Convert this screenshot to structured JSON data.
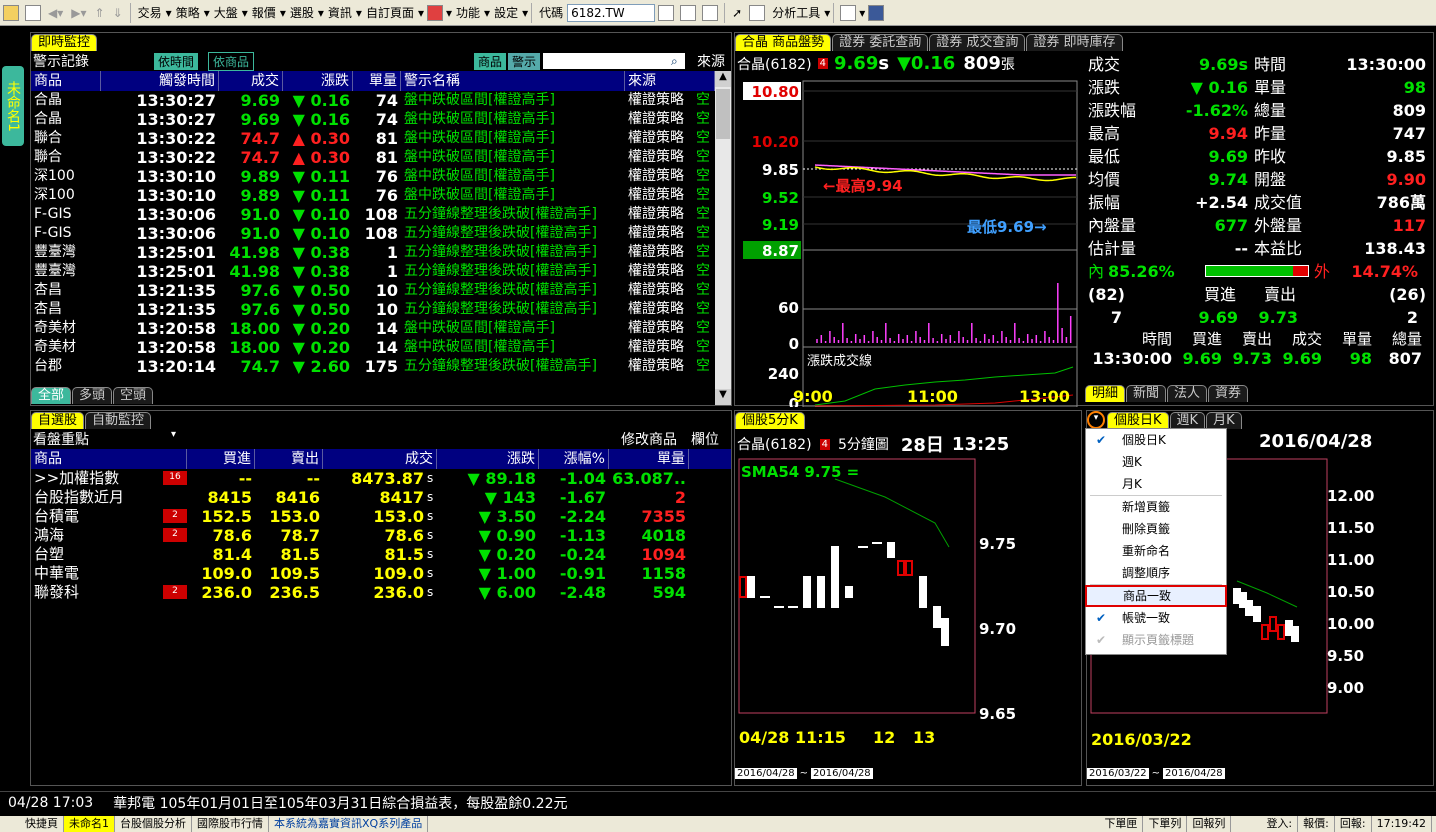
{
  "toolbar": {
    "items": [
      "交易",
      "策略",
      "大盤",
      "報價",
      "選股",
      "資訊",
      "自訂頁面",
      "功能",
      "設定"
    ],
    "code_label": "代碼",
    "code_value": "6182.TW",
    "analysis": "分析工具"
  },
  "sidetab": "未命名1",
  "alerts": {
    "tab": "即時監控",
    "title": "警示記錄",
    "btn_time": "依時間",
    "btn_product": "依商品",
    "search_tabs": [
      "商品",
      "警示"
    ],
    "source": "來源",
    "columns": [
      "商品",
      "觸發時間",
      "成交",
      "漲跌",
      "單量",
      "警示名稱",
      "來源"
    ],
    "rows": [
      [
        "合晶",
        "13:30:27",
        "9.69",
        "▼",
        "0.16",
        "74",
        "盤中跌破區間[權證高手]",
        "權證策略",
        "空",
        "g"
      ],
      [
        "合晶",
        "13:30:27",
        "9.69",
        "▼",
        "0.16",
        "74",
        "盤中跌破區間[權證高手]",
        "權證策略",
        "空",
        "g"
      ],
      [
        "聯合",
        "13:30:22",
        "74.7",
        "▲",
        "0.30",
        "81",
        "盤中跌破區間[權證高手]",
        "權證策略",
        "空",
        "r"
      ],
      [
        "聯合",
        "13:30:22",
        "74.7",
        "▲",
        "0.30",
        "81",
        "盤中跌破區間[權證高手]",
        "權證策略",
        "空",
        "r"
      ],
      [
        "深100",
        "13:30:10",
        "9.89",
        "▼",
        "0.11",
        "76",
        "盤中跌破區間[權證高手]",
        "權證策略",
        "空",
        "g"
      ],
      [
        "深100",
        "13:30:10",
        "9.89",
        "▼",
        "0.11",
        "76",
        "盤中跌破區間[權證高手]",
        "權證策略",
        "空",
        "g"
      ],
      [
        "F-GIS",
        "13:30:06",
        "91.0",
        "▼",
        "0.10",
        "108",
        "五分鐘線整理後跌破[權證高手]",
        "權證策略",
        "空",
        "g"
      ],
      [
        "F-GIS",
        "13:30:06",
        "91.0",
        "▼",
        "0.10",
        "108",
        "五分鐘線整理後跌破[權證高手]",
        "權證策略",
        "空",
        "g"
      ],
      [
        "豐臺灣",
        "13:25:01",
        "41.98",
        "▼",
        "0.38",
        "1",
        "五分鐘線整理後跌破[權證高手]",
        "權證策略",
        "空",
        "g"
      ],
      [
        "豐臺灣",
        "13:25:01",
        "41.98",
        "▼",
        "0.38",
        "1",
        "五分鐘線整理後跌破[權證高手]",
        "權證策略",
        "空",
        "g"
      ],
      [
        "杏昌",
        "13:21:35",
        "97.6",
        "▼",
        "0.50",
        "10",
        "五分鐘線整理後跌破[權證高手]",
        "權證策略",
        "空",
        "g"
      ],
      [
        "杏昌",
        "13:21:35",
        "97.6",
        "▼",
        "0.50",
        "10",
        "五分鐘線整理後跌破[權證高手]",
        "權證策略",
        "空",
        "g"
      ],
      [
        "奇美材",
        "13:20:58",
        "18.00",
        "▼",
        "0.20",
        "14",
        "盤中跌破區間[權證高手]",
        "權證策略",
        "空",
        "g"
      ],
      [
        "奇美材",
        "13:20:58",
        "18.00",
        "▼",
        "0.20",
        "14",
        "盤中跌破區間[權證高手]",
        "權證策略",
        "空",
        "g"
      ],
      [
        "台郡",
        "13:20:14",
        "74.7",
        "▼",
        "2.60",
        "175",
        "五分鐘線整理後跌破[權證高手]",
        "權證策略",
        "空",
        "g"
      ]
    ],
    "bottom_tabs": [
      "全部",
      "多頭",
      "空頭"
    ]
  },
  "watch": {
    "tabs": [
      "自選股",
      "自動監控"
    ],
    "view": "看盤重點",
    "edit": "修改商品",
    "cols_btn": "欄位",
    "columns": [
      "商品",
      "買進",
      "賣出",
      "成交",
      "漲跌",
      "漲幅%",
      "單量"
    ],
    "rows": [
      [
        ">>加權指數",
        "16",
        "--",
        "--",
        "8473.87",
        "s",
        "▼",
        "89.18",
        "-1.04",
        "63.087..",
        "g"
      ],
      [
        "台股指數近月",
        "",
        "8415",
        "8416",
        "8417",
        "s",
        "▼",
        "143",
        "-1.67",
        "2",
        "r"
      ],
      [
        "台積電",
        "2",
        "152.5",
        "153.0",
        "153.0",
        "s",
        "▼",
        "3.50",
        "-2.24",
        "7355",
        "r"
      ],
      [
        "鴻海",
        "2",
        "78.6",
        "78.7",
        "78.6",
        "s",
        "▼",
        "0.90",
        "-1.13",
        "4018",
        "g"
      ],
      [
        "台塑",
        "",
        "81.4",
        "81.5",
        "81.5",
        "s",
        "▼",
        "0.20",
        "-0.24",
        "1094",
        "r"
      ],
      [
        "中華電",
        "",
        "109.0",
        "109.5",
        "109.0",
        "s",
        "▼",
        "1.00",
        "-0.91",
        "1158",
        "g"
      ],
      [
        "聯發科",
        "2",
        "236.0",
        "236.5",
        "236.0",
        "s",
        "▼",
        "6.00",
        "-2.48",
        "594",
        "g"
      ]
    ]
  },
  "quote": {
    "tabs": [
      "合晶 商品盤勢",
      "證券 委託查詢",
      "證券 成交查詢",
      "證券 即時庫存"
    ],
    "name": "合晶(6182)",
    "badge": "4",
    "price": "9.69",
    "flag": "s",
    "arrow": "▼",
    "chg": "0.16",
    "vol": "809",
    "vol_unit": "張",
    "y_labels": [
      "10.80",
      "10.20",
      "9.85",
      "9.52",
      "9.19",
      "8.87"
    ],
    "vol_labels": [
      "60",
      "0"
    ],
    "line_label": "漲跌成交線",
    "line_vals": [
      "240",
      "0"
    ],
    "high_note": "←最高9.94",
    "low_note": "最低9.69→",
    "x_labels": [
      "9:00",
      "11:00",
      "13:00"
    ],
    "detail": [
      [
        "成交",
        "9.69s",
        "時間",
        "13:30:00"
      ],
      [
        "漲跌",
        "▼ 0.16",
        "單量",
        "98"
      ],
      [
        "漲跌幅",
        "-1.62%",
        "總量",
        "809"
      ],
      [
        "最高",
        "9.94",
        "昨量",
        "747"
      ],
      [
        "最低",
        "9.69",
        "昨收",
        "9.85"
      ],
      [
        "均價",
        "9.74",
        "開盤",
        "9.90"
      ],
      [
        "振幅",
        "+2.54",
        "成交值",
        "786萬"
      ],
      [
        "內盤量",
        "677",
        "外盤量",
        "117"
      ],
      [
        "估計量",
        "--",
        "本益比",
        "138.43"
      ]
    ],
    "inner_label": "內",
    "inner_pct": "85.26%",
    "outer_label": "外",
    "outer_pct": "14.74%",
    "bid_count": "(82)",
    "ask_count": "(26)",
    "bid_label": "買進",
    "ask_label": "賣出",
    "bid_qty": "7",
    "bid": "9.69",
    "ask": "9.73",
    "ask_qty": "2",
    "tick_cols": [
      "時間",
      "買進",
      "賣出",
      "成交",
      "單量",
      "總量"
    ],
    "tick_row": [
      "13:30:00",
      "9.69",
      "9.73",
      "9.69",
      "98",
      "807"
    ],
    "bottom_tabs": [
      "明細",
      "新聞",
      "法人",
      "資券"
    ]
  },
  "k5": {
    "tab": "個股5分K",
    "name": "合晶(6182)",
    "badge": "4",
    "period": "5分鐘圖",
    "date": "28日",
    "time": "13:25",
    "sma": "SMA54 9.75 =",
    "y_labels": [
      "9.75",
      "9.70",
      "9.65"
    ],
    "x_labels": [
      "04/28 11:15",
      "12",
      "13"
    ],
    "from": "2016/04/28",
    "to": "2016/04/28"
  },
  "kday": {
    "tabs": [
      "個股日K",
      "週K",
      "月K"
    ],
    "date": "2016/04/28",
    "y_labels": [
      "12.00",
      "11.50",
      "11.00",
      "10.50",
      "10.00",
      "9.50",
      "9.00"
    ],
    "x_label": "2016/03/22",
    "from": "2016/03/22",
    "to": "2016/04/28"
  },
  "menu": {
    "items": [
      "個股日K",
      "週K",
      "月K",
      "新增頁籤",
      "刪除頁籤",
      "重新命名",
      "調整順序",
      "商品一致",
      "帳號一致",
      "顯示頁籤標題"
    ]
  },
  "news": {
    "time": "04/28 17:03",
    "text": "華邦電 105年01月01日至105年03月31日綜合損益表，每股盈餘0.22元"
  },
  "status": {
    "tabs": [
      "快捷頁",
      "未命名1",
      "台股個股分析",
      "國際股市行情",
      "本系統為嘉實資訊XQ系列產品"
    ],
    "right": [
      "下單匣",
      "下單列",
      "回報列",
      "登入:",
      "報價:",
      "回報:",
      "17:19:42"
    ]
  }
}
